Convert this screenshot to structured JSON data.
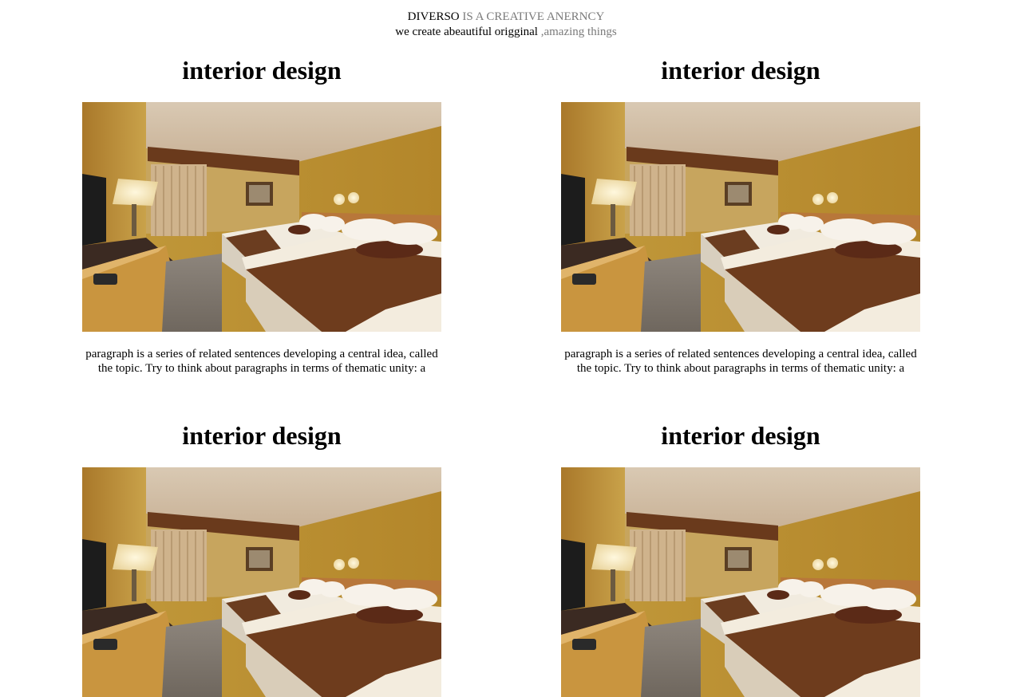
{
  "header": {
    "brand": "DIVERSO",
    "tagline_rest": " IS A CREATIVE ANERNCY",
    "subline_main": "we create abeautiful origginal ",
    "subline_muted": ",amazing things"
  },
  "cards": [
    {
      "title": "interior design",
      "image_alt": "hotel room with two beds",
      "text": "paragraph is a series of related sentences developing a central idea, called the topic. Try to think about paragraphs in terms of thematic unity: a"
    },
    {
      "title": "interior design",
      "image_alt": "hotel room with two beds",
      "text": "paragraph is a series of related sentences developing a central idea, called the topic. Try to think about paragraphs in terms of thematic unity: a"
    },
    {
      "title": "interior design",
      "image_alt": "hotel room with two beds"
    },
    {
      "title": "interior design",
      "image_alt": "hotel room with two beds"
    }
  ]
}
